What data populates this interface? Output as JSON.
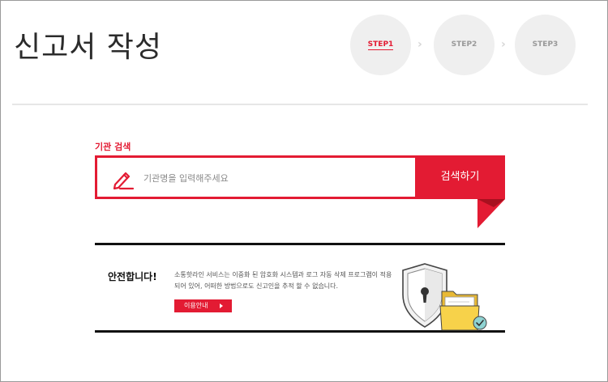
{
  "page": {
    "title": "신고서 작성"
  },
  "steps": [
    {
      "label": "STEP1",
      "active": true
    },
    {
      "label": "STEP2",
      "active": false
    },
    {
      "label": "STEP3",
      "active": false
    }
  ],
  "search": {
    "section_label": "기관 검색",
    "placeholder": "기관명을 입력해주세요",
    "value": "",
    "button_label": "검색하기",
    "icon": "pencil-icon"
  },
  "safety": {
    "title": "안전합니다!",
    "description": "소통핫라인 서비스는 이중화 된 암호화 시스템과 로그 자동 삭제 프로그램이 적용되어 있어, 어떠한 방법으로도 신고인을 추적 할 수 없습니다.",
    "guide_button_label": "이용안내",
    "illustration": "shield-folder-illustration"
  },
  "colors": {
    "accent": "#e31b33",
    "step_bg": "#efefef",
    "divider": "#e6e6e6",
    "rule": "#111111"
  }
}
